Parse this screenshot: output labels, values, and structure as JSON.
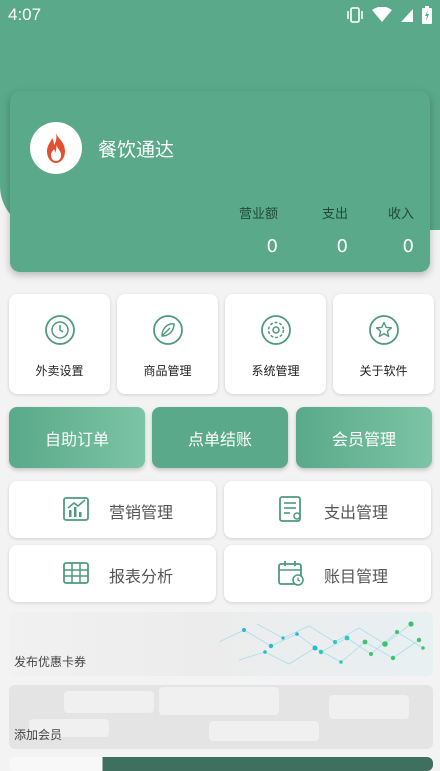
{
  "status_bar": {
    "time": "4:07"
  },
  "app": {
    "name": "餐饮通达"
  },
  "stats": [
    {
      "label": "营业额",
      "value": "0"
    },
    {
      "label": "支出",
      "value": "0"
    },
    {
      "label": "收入",
      "value": "0"
    }
  ],
  "quick_actions": [
    {
      "label": "外卖设置",
      "icon": "clock-icon"
    },
    {
      "label": "商品管理",
      "icon": "leaf-icon"
    },
    {
      "label": "系统管理",
      "icon": "gear-icon"
    },
    {
      "label": "关于软件",
      "icon": "star-icon"
    }
  ],
  "primary_actions": [
    "自助订单",
    "点单结账",
    "会员管理"
  ],
  "management": [
    {
      "label": "营销管理",
      "icon": "chart-icon"
    },
    {
      "label": "支出管理",
      "icon": "document-icon"
    },
    {
      "label": "报表分析",
      "icon": "table-icon"
    },
    {
      "label": "账目管理",
      "icon": "calendar-icon"
    }
  ],
  "banners": [
    {
      "label": "发布优惠卡券"
    },
    {
      "label": "添加会员"
    }
  ],
  "colors": {
    "primary": "#5aa98a",
    "logo_flame": "#e2502f"
  }
}
